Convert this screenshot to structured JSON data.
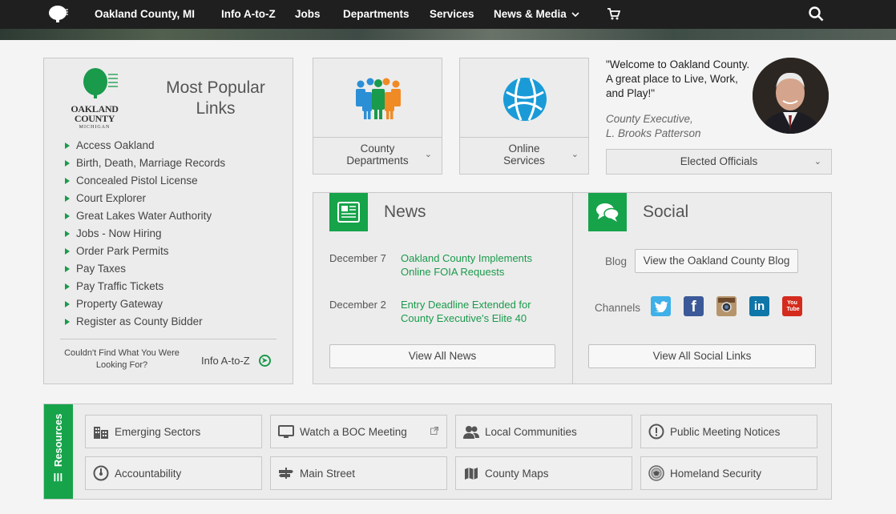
{
  "nav": {
    "site_title": "Oakland County, MI",
    "items": [
      "Info A-to-Z",
      "Jobs",
      "Departments",
      "Services",
      "News & Media"
    ],
    "cart_icon": "cart-icon",
    "search_icon": "search-icon"
  },
  "popular": {
    "title": "Most Popular Links",
    "logo_text": "OAKLAND COUNTY",
    "logo_sub": "MICHIGAN",
    "links": [
      "Access Oakland",
      "Birth, Death, Marriage Records",
      "Concealed Pistol License",
      "Court Explorer",
      "Great Lakes Water Authority",
      "Jobs - Now Hiring",
      "Order Park Permits",
      "Pay Taxes",
      "Pay Traffic Tickets",
      "Property Gateway",
      "Register as County Bidder"
    ],
    "couldnt_find": "Couldn't Find What You Were Looking For?",
    "info_az": "Info A-to-Z"
  },
  "tiles": {
    "departments": "County Departments",
    "services": "Online Services"
  },
  "executive": {
    "quote": "\"Welcome to Oakland County. A great place to Live, Work, and Play!\"",
    "title": "County Executive,",
    "name": "L. Brooks Patterson",
    "elected_button": "Elected Officials"
  },
  "news": {
    "heading": "News",
    "items": [
      {
        "date": "December 7",
        "headline": "Oakland County Implements Online FOIA Requests"
      },
      {
        "date": "December 2",
        "headline": "Entry Deadline Extended for County Executive's Elite 40"
      }
    ],
    "view_all": "View All News"
  },
  "social": {
    "heading": "Social",
    "blog_label": "Blog",
    "blog_button": "View the Oakland County Blog",
    "channels_label": "Channels",
    "channels": [
      "twitter-icon",
      "facebook-icon",
      "instagram-icon",
      "linkedin-icon",
      "youtube-icon"
    ],
    "youtube_text": "You Tube",
    "view_all": "View All Social Links"
  },
  "resources": {
    "label": "Resources",
    "items": [
      "Emerging Sectors",
      "Watch a BOC Meeting",
      "Local Communities",
      "Public Meeting Notices",
      "Accountability",
      "Main Street",
      "County Maps",
      "Homeland Security"
    ]
  },
  "colors": {
    "accent": "#16a34a",
    "nav_bg": "#1f1f1f"
  }
}
